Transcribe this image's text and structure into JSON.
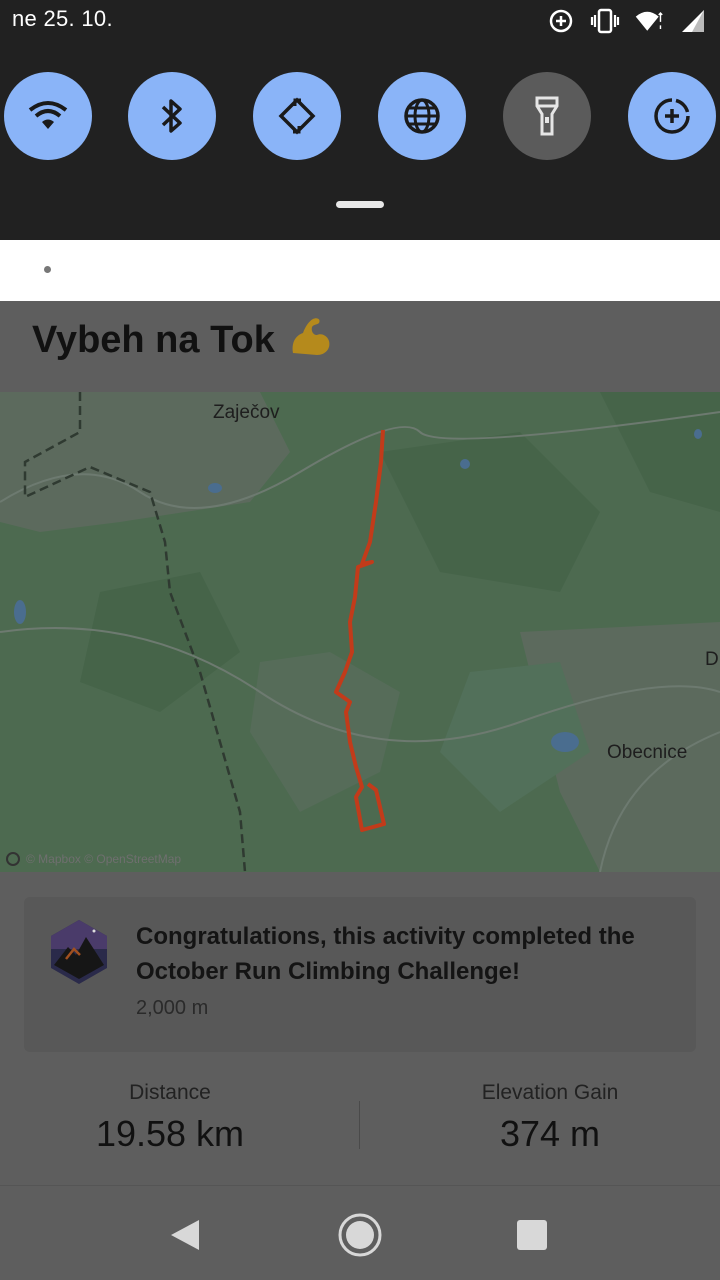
{
  "status_bar": {
    "date": "ne 25. 10.",
    "icons": [
      "data-saver-icon",
      "vibrate-icon",
      "wifi-icon",
      "cell-signal-icon"
    ]
  },
  "quick_settings": {
    "tiles": [
      {
        "name": "wifi-icon",
        "state": "on"
      },
      {
        "name": "bluetooth-icon",
        "state": "on"
      },
      {
        "name": "auto-rotate-icon",
        "state": "on"
      },
      {
        "name": "globe-icon",
        "state": "on"
      },
      {
        "name": "flashlight-icon",
        "state": "off"
      },
      {
        "name": "data-saver-icon",
        "state": "on"
      }
    ],
    "accent": "#8ab4f8"
  },
  "activity": {
    "title": "Vybeh na Tok",
    "title_emoji": "💪"
  },
  "map": {
    "labels": {
      "town_top": "Zaječov",
      "town_right": "Obecnice",
      "edge_label": "Dr"
    },
    "attribution": "© Mapbox © OpenStreetMap",
    "route_color": "#c23b1a"
  },
  "challenge_card": {
    "text": "Congratulations, this activity completed the October Run Climbing Challenge!",
    "goal": "2,000 m"
  },
  "stats": {
    "distance_label": "Distance",
    "distance_value": "19.58 km",
    "elevation_label": "Elevation Gain",
    "elevation_value": "374 m"
  },
  "nav": [
    "back-icon",
    "home-icon",
    "recents-icon"
  ]
}
